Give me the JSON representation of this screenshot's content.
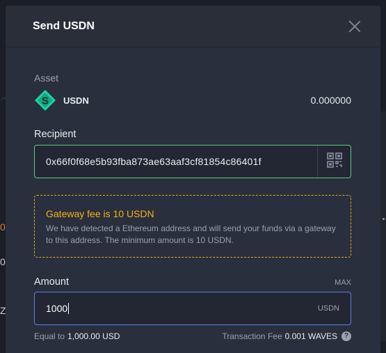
{
  "modal": {
    "title": "Send USDN"
  },
  "asset": {
    "label": "Asset",
    "name": "USDN",
    "balance": "0.000000",
    "icon_color": "#1ed3a4"
  },
  "recipient": {
    "label": "Recipient",
    "value": "0x66f0f68e5b93fba873ae63aaf3cf81854c86401f"
  },
  "warning": {
    "title": "Gateway fee is 10 USDN",
    "text": "We have detected a Ethereum address and will send your funds via a gateway to this address. The minimum amount is 10 USDN."
  },
  "amount": {
    "label": "Amount",
    "max_label": "MAX",
    "value": "1000",
    "unit": "USDN"
  },
  "footer": {
    "equal_to_label": "Equal to",
    "equal_to_value": "1,000.00 USD",
    "fee_label": "Transaction Fee",
    "fee_value": "0.001 WAVES",
    "help": "?"
  },
  "background": {
    "frag_a": "0",
    "frag_b": "0(",
    "frag_c": "Z"
  },
  "colors": {
    "accent_green": "#5ecc7b",
    "accent_blue": "#5a80e6",
    "warning": "#f5b11a"
  }
}
